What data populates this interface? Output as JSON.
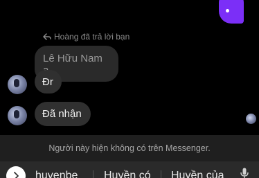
{
  "conversation": {
    "reply_hint": "Hoàng đã trả lời bạn",
    "quoted_message": "Lê Hữu Nam a",
    "messages": [
      {
        "text": "Đr"
      },
      {
        "text": "Đã nhận"
      }
    ]
  },
  "notice": {
    "text": "Người này hiện không có trên Messenger."
  },
  "keyboard": {
    "suggestions": [
      "huyenbe",
      "Huyền có",
      "Huyền của"
    ]
  },
  "colors": {
    "accent": "#7b2ff7",
    "bubble": "#303030",
    "quoted_bubble": "#2a2a2a",
    "notice_bar": "#1f1f1f"
  }
}
